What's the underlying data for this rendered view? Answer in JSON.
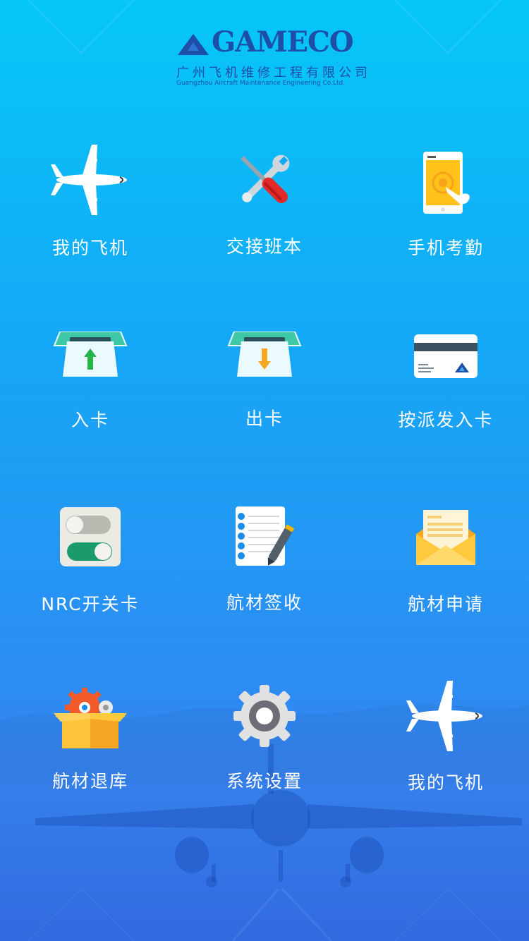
{
  "brand": {
    "wordmark": "GAMECO",
    "name_cn": "广州飞机维修工程有限公司",
    "name_en": "Guangzhou Aircraft Maintenance Engineering Co.Ltd."
  },
  "menu": [
    {
      "label": "我的飞机",
      "icon": "airplane-icon"
    },
    {
      "label": "交接班本",
      "icon": "tools-icon"
    },
    {
      "label": "手机考勤",
      "icon": "phone-attendance-icon"
    },
    {
      "label": "入卡",
      "icon": "card-in-icon"
    },
    {
      "label": "出卡",
      "icon": "card-out-icon"
    },
    {
      "label": "按派发入卡",
      "icon": "dispatch-card-icon"
    },
    {
      "label": "NRC开关卡",
      "icon": "toggle-switch-icon"
    },
    {
      "label": "航材签收",
      "icon": "notepad-pen-icon"
    },
    {
      "label": "航材申请",
      "icon": "envelope-icon"
    },
    {
      "label": "航材退库",
      "icon": "box-gears-icon"
    },
    {
      "label": "系统设置",
      "icon": "gear-icon"
    },
    {
      "label": "我的飞机",
      "icon": "airplane-icon"
    }
  ],
  "colors": {
    "background_top": "#06c7f8",
    "background_bottom": "#3a7ff0",
    "brand_blue": "#1d4fa8"
  }
}
